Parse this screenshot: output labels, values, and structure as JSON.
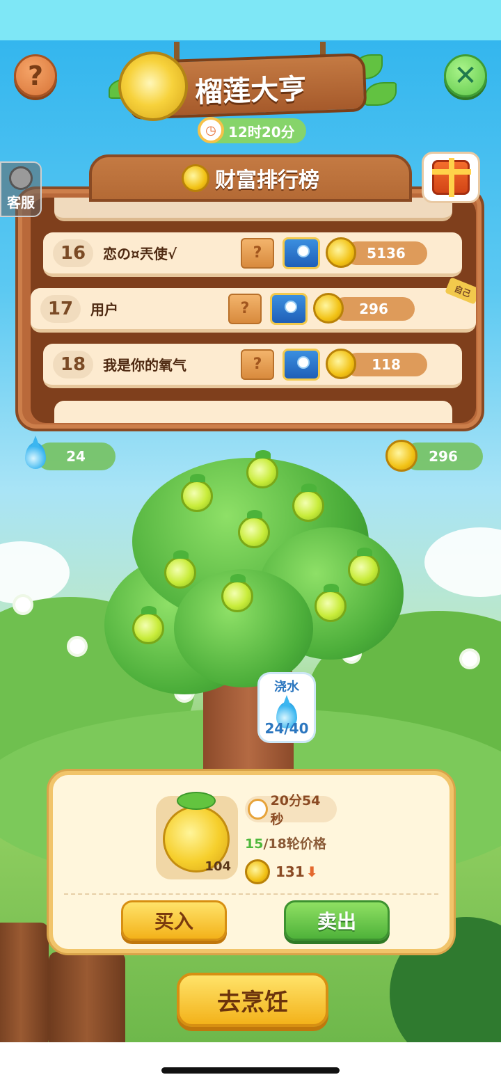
{
  "title": "榴莲大亨",
  "timer": "12时20分",
  "leaderboard": {
    "title": "财富排行榜",
    "rows": [
      {
        "rank": "16",
        "name": "恋の¤兲使√",
        "coins": "5136",
        "self": false
      },
      {
        "rank": "17",
        "name": "用户",
        "coins": "296",
        "self": true
      },
      {
        "rank": "18",
        "name": "我是你的氧气",
        "coins": "118",
        "self": false
      }
    ],
    "self_tag": "自己",
    "mystery_mark": "?"
  },
  "support_label": "客服",
  "water_count": "24",
  "coin_count": "296",
  "watering": {
    "label": "浇水",
    "progress": "24/40"
  },
  "market": {
    "fruit_qty": "104",
    "countdown": "20分54秒",
    "round_current": "15",
    "round_rest": "/18轮价格",
    "price": "131",
    "trend_arrow": "⬇",
    "buy_label": "买入",
    "sell_label": "卖出"
  },
  "cook_label": "去烹饪",
  "icons": {
    "help": "?",
    "close": "✕"
  },
  "colors": {
    "accent_orange": "#de9b5a",
    "green": "#4fb23a",
    "yellow": "#f3b21a"
  }
}
